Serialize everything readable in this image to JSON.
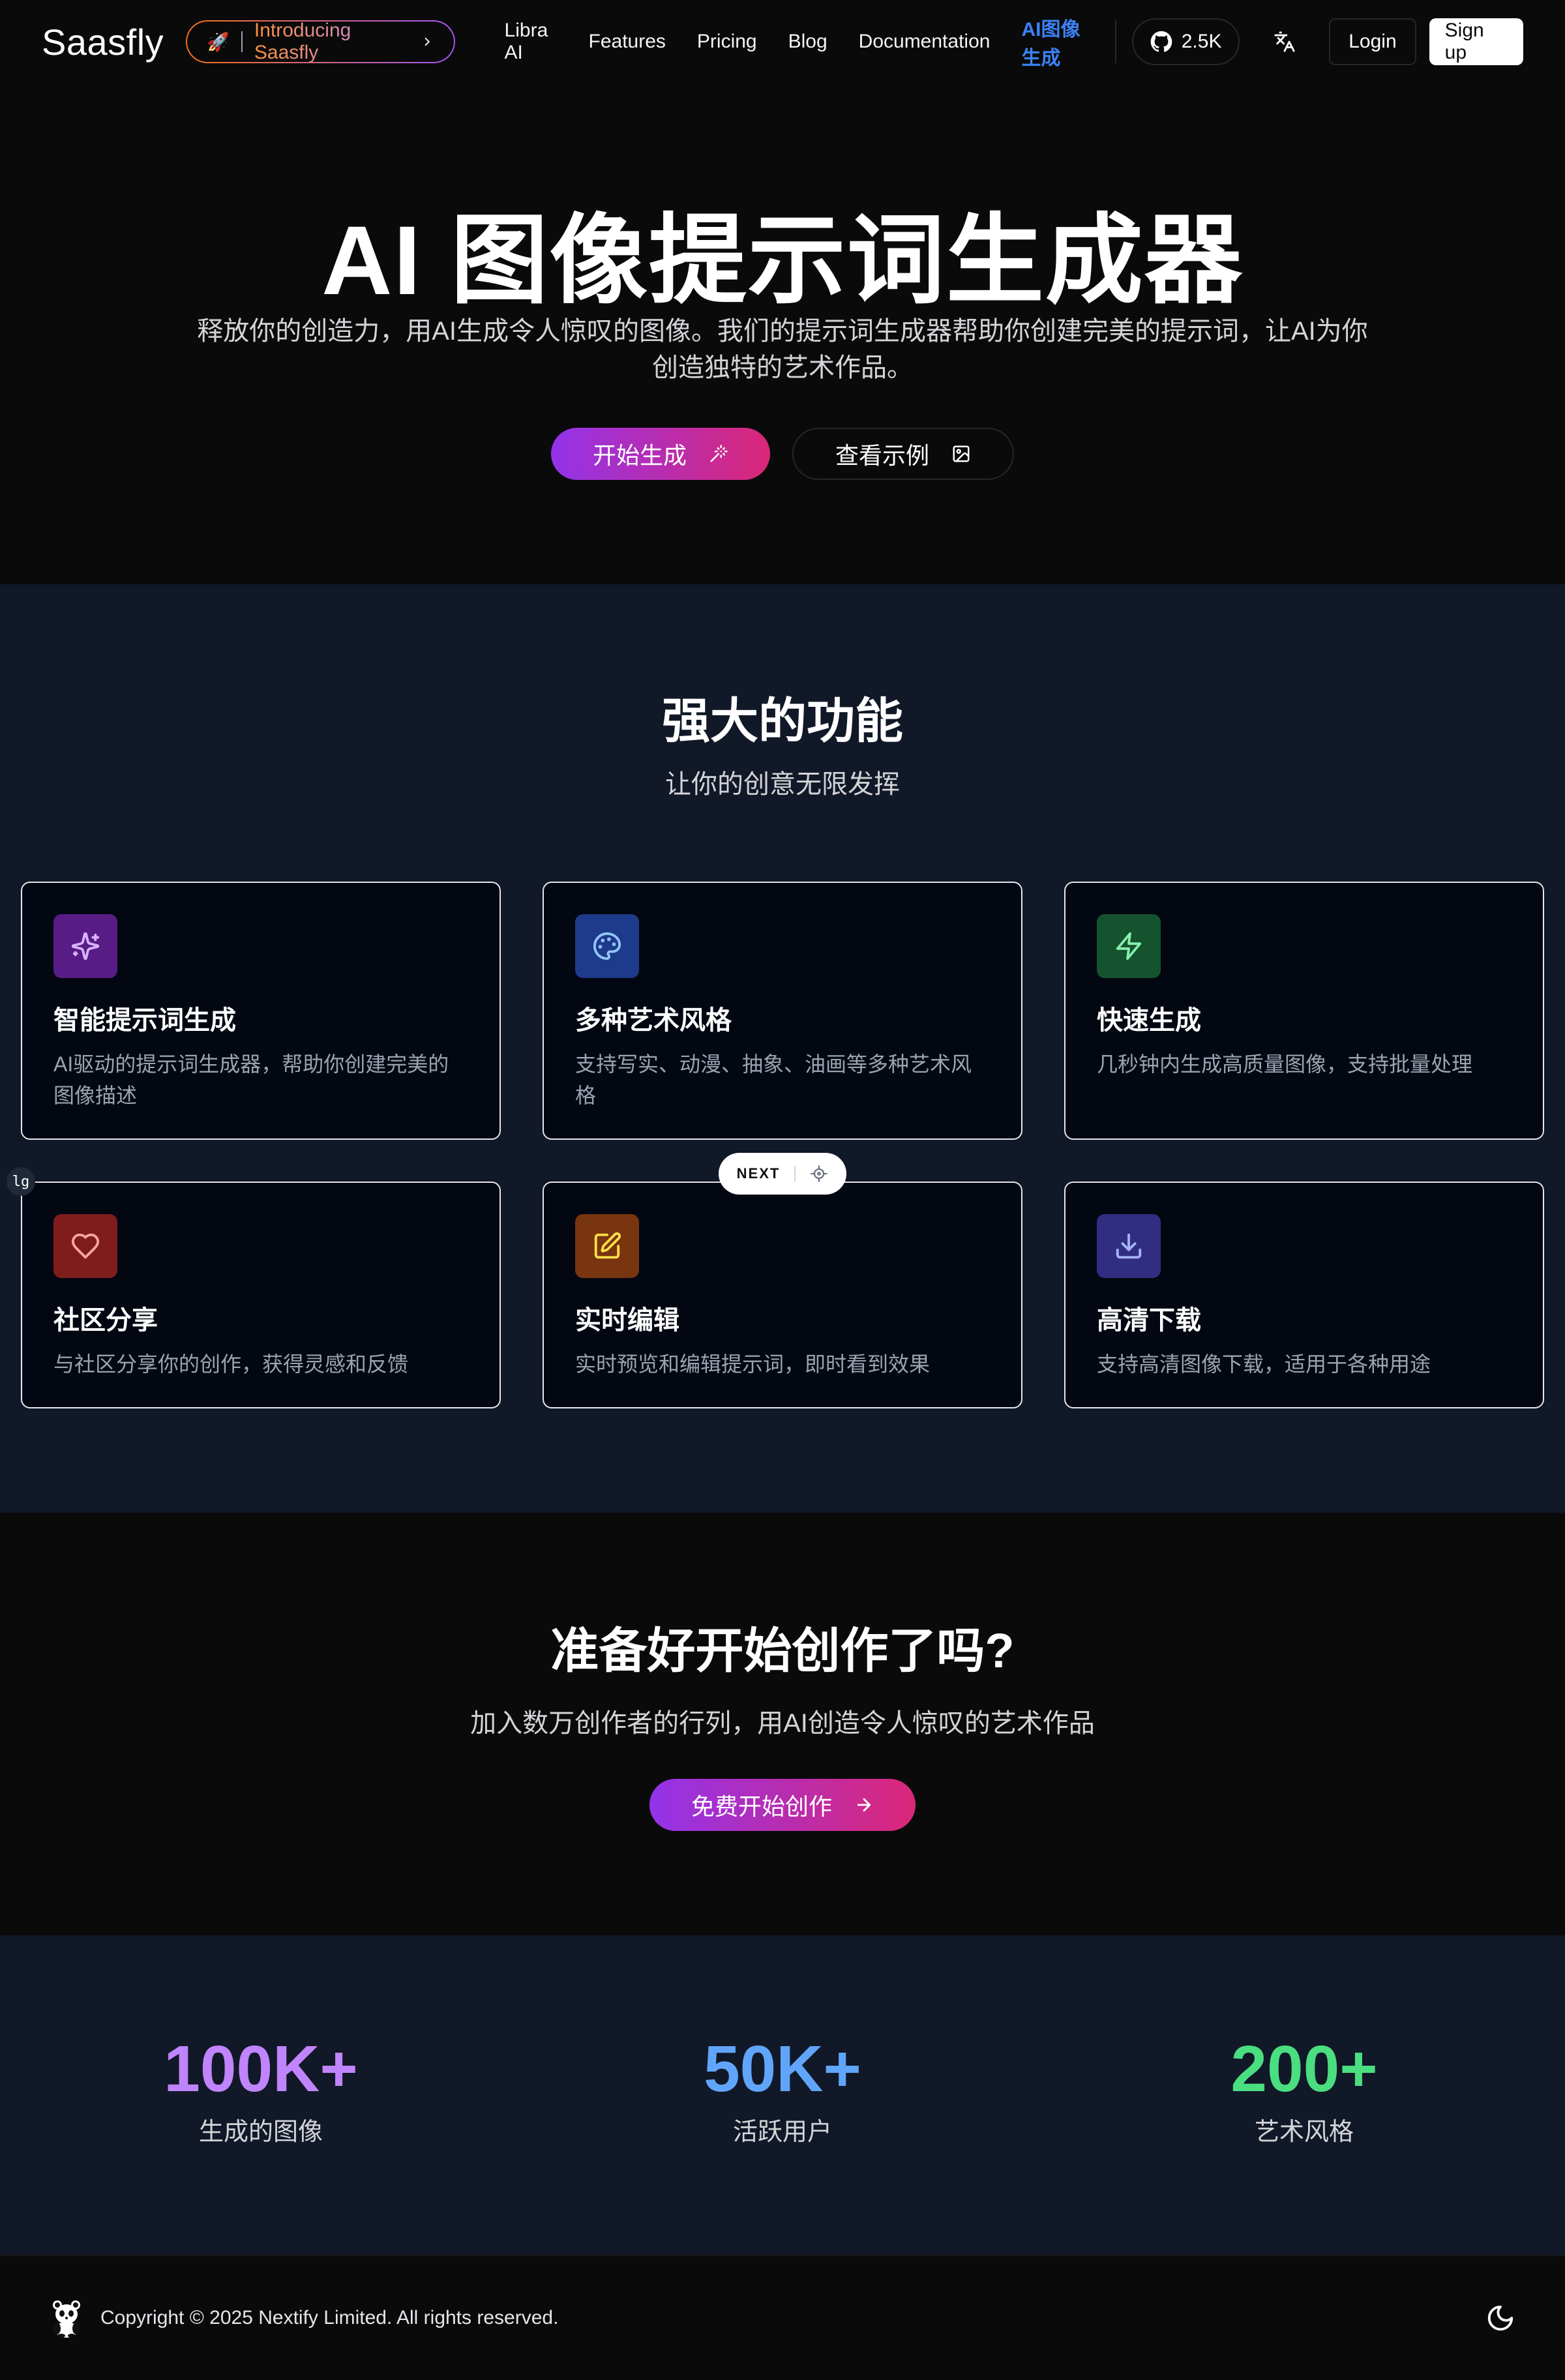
{
  "nav": {
    "brand": "Saasfly",
    "intro": {
      "emoji": "🚀",
      "text": "Introducing Saasfly"
    },
    "links": [
      "Libra AI",
      "Features",
      "Pricing",
      "Blog",
      "Documentation",
      "AI图像生成"
    ],
    "github_count": "2.5K",
    "login": "Login",
    "signup": "Sign up"
  },
  "hero": {
    "title": "AI 图像提示词生成器",
    "subtitle": "释放你的创造力，用AI生成令人惊叹的图像。我们的提示词生成器帮助你创建完美的提示词，让AI为你创造独特的艺术作品。",
    "primary_btn": "开始生成",
    "secondary_btn": "查看示例"
  },
  "features": {
    "title": "强大的功能",
    "subtitle": "让你的创意无限发挥",
    "items": [
      {
        "title": "智能提示词生成",
        "desc": "AI驱动的提示词生成器，帮助你创建完美的图像描述",
        "icon": "sparkles-icon",
        "icon_bg": "#581c87",
        "icon_color": "#d8b4fe"
      },
      {
        "title": "多种艺术风格",
        "desc": "支持写实、动漫、抽象、油画等多种艺术风格",
        "icon": "palette-icon",
        "icon_bg": "#1e3a8a",
        "icon_color": "#93c5fd"
      },
      {
        "title": "快速生成",
        "desc": "几秒钟内生成高质量图像，支持批量处理",
        "icon": "zap-icon",
        "icon_bg": "#14532d",
        "icon_color": "#86efac"
      },
      {
        "title": "社区分享",
        "desc": "与社区分享你的创作，获得灵感和反馈",
        "icon": "heart-icon",
        "icon_bg": "#7f1d1d",
        "icon_color": "#fca5a5"
      },
      {
        "title": "实时编辑",
        "desc": "实时预览和编辑提示词，即时看到效果",
        "icon": "edit-icon",
        "icon_bg": "#78350f",
        "icon_color": "#fde047"
      },
      {
        "title": "高清下载",
        "desc": "支持高清图像下载，适用于各种用途",
        "icon": "download-icon",
        "icon_bg": "#312e81",
        "icon_color": "#a5b4fc"
      }
    ]
  },
  "dev": {
    "next_label": "NEXT",
    "breakpoint": "lg"
  },
  "cta": {
    "title": "准备好开始创作了吗?",
    "subtitle": "加入数万创作者的行列，用AI创造令人惊叹的艺术作品",
    "button": "免费开始创作"
  },
  "stats": [
    {
      "value": "100K+",
      "label": "生成的图像",
      "color": "#c084fc"
    },
    {
      "value": "50K+",
      "label": "活跃用户",
      "color": "#60a5fa"
    },
    {
      "value": "200+",
      "label": "艺术风格",
      "color": "#4ade80"
    }
  ],
  "footer": {
    "copyright": "Copyright © 2025 Nextify Limited. All rights reserved."
  }
}
